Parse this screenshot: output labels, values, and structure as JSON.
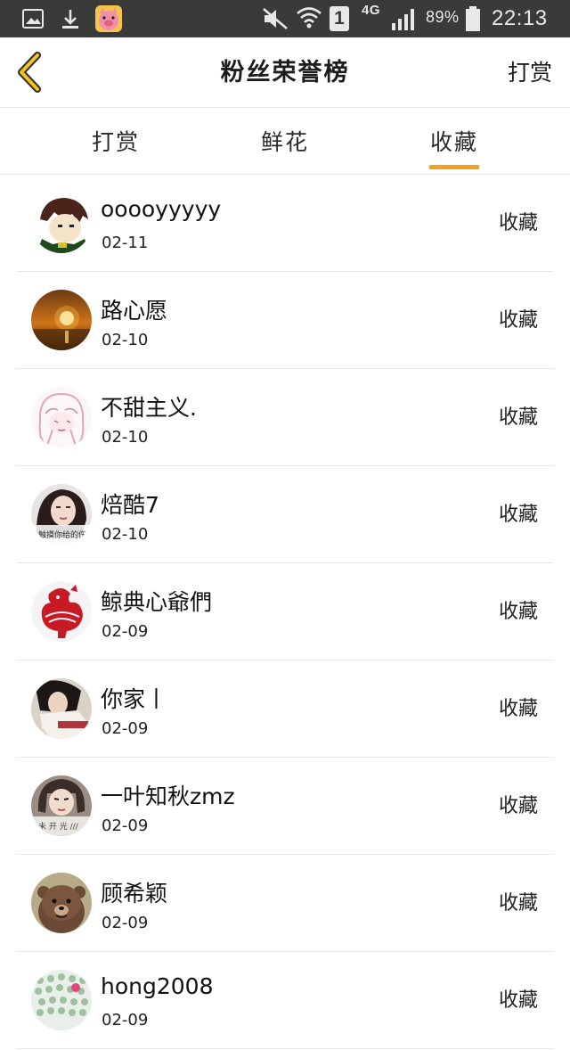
{
  "status_bar": {
    "battery": "89%",
    "time": "22:13",
    "network": "4G",
    "sim": "1",
    "icons": [
      "image-icon",
      "download-icon",
      "app-pig-icon",
      "mute-icon",
      "wifi-icon",
      "signal-icon",
      "battery-icon"
    ]
  },
  "header": {
    "title": "粉丝荣誉榜",
    "action": "打赏",
    "back_icon": "chevron-left-icon",
    "accent": "#f2c21d"
  },
  "tabs": [
    {
      "label": "打赏",
      "active": false
    },
    {
      "label": "鲜花",
      "active": false
    },
    {
      "label": "收藏",
      "active": true
    }
  ],
  "colors": {
    "tab_indicator": "#f2a01d",
    "divider": "#e8e8e8",
    "status_bar_bg": "#3a3a3a"
  },
  "list": [
    {
      "name": "ooooyyyyy",
      "date": "02-11",
      "action": "收藏"
    },
    {
      "name": "路心愿",
      "date": "02-10",
      "action": "收藏"
    },
    {
      "name": "不甜主义.",
      "date": "02-10",
      "action": "收藏"
    },
    {
      "name": "焙酷7",
      "date": "02-10",
      "action": "收藏"
    },
    {
      "name": "鲸典心爺們",
      "date": "02-09",
      "action": "收藏"
    },
    {
      "name": "你家丨",
      "date": "02-09",
      "action": "收藏"
    },
    {
      "name": "一叶知秋zmz",
      "date": "02-09",
      "action": "收藏"
    },
    {
      "name": "顾希颖",
      "date": "02-09",
      "action": "收藏"
    },
    {
      "name": "hong2008",
      "date": "02-09",
      "action": "收藏"
    }
  ]
}
